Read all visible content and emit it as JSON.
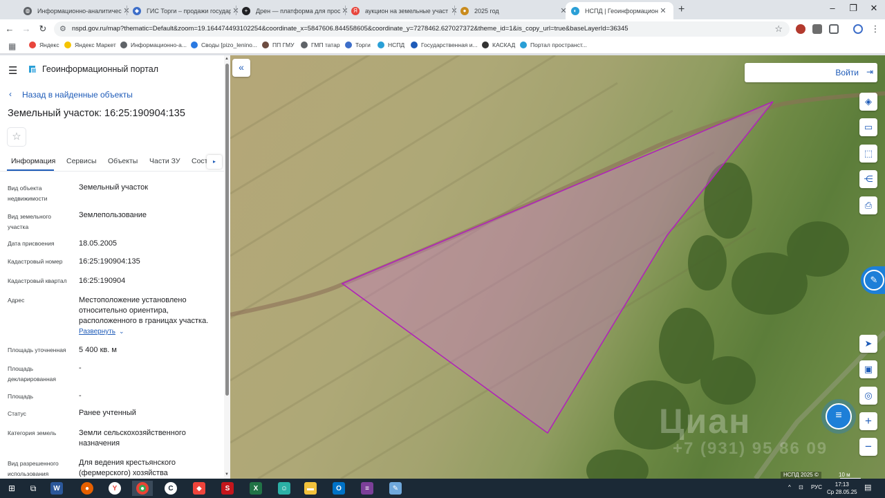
{
  "browser": {
    "tabs": [
      {
        "title": "Информационно-аналитичес",
        "color": "#5f6368",
        "active": false
      },
      {
        "title": "ГИС Торги – продажи государ",
        "color": "#3d6ec9",
        "active": false
      },
      {
        "title": "Дрен — платформа для прос",
        "color": "#202124",
        "active": false
      },
      {
        "title": "аукцион на земельные участ",
        "color": "#e8453c",
        "active": false
      },
      {
        "title": "2025 год",
        "color": "#c98b1d",
        "active": false
      },
      {
        "title": "НСПД | Геоинформационный",
        "color": "#2a9fd6",
        "active": true
      }
    ],
    "new_tab": "+",
    "url": "nspd.gov.ru/map?thematic=Default&zoom=19.164474493102254&coordinate_x=5847606.844558605&coordinate_y=7278462.627027372&theme_id=1&is_copy_url=true&baseLayerId=36345",
    "bookmarks": [
      {
        "label": "Яндекс",
        "color": "#e8453c"
      },
      {
        "label": "Яндекс Маркет",
        "color": "#f5c400"
      },
      {
        "label": "Информационно-а...",
        "color": "#5f6368"
      },
      {
        "label": "Своды [pizo_lenino...",
        "color": "#2a7ae2"
      },
      {
        "label": "ПП ГМУ",
        "color": "#6d4c41"
      },
      {
        "label": "ГМП татар",
        "color": "#5f6368"
      },
      {
        "label": "Торги",
        "color": "#3d6ec9"
      },
      {
        "label": "НСПД",
        "color": "#2a9fd6"
      },
      {
        "label": "Государственная и...",
        "color": "#1e5bb8"
      },
      {
        "label": "КАСКАД",
        "color": "#333333"
      },
      {
        "label": "Портал пространст...",
        "color": "#2a9fd6"
      }
    ]
  },
  "panel": {
    "portal_title": "Геоинформационный портал",
    "back_link": "Назад в найденные объекты",
    "object_title": "Земельный участок: 16:25:190904:135",
    "tabs": [
      "Информация",
      "Сервисы",
      "Объекты",
      "Части ЗУ",
      "Сост"
    ],
    "tab_arrow": "▸",
    "properties": [
      {
        "label": "Вид объекта недвижимости",
        "value": "Земельный участок"
      },
      {
        "label": "Вид земельного участка",
        "value": "Землепользование"
      },
      {
        "label": "Дата присвоения",
        "value": "18.05.2005"
      },
      {
        "label": "Кадастровый номер",
        "value": "16:25:190904:135"
      },
      {
        "label": "Кадастровый квартал",
        "value": "16:25:190904"
      },
      {
        "label": "Адрес",
        "value": "Местоположение установлено относительно ориентира, расположенного в границах участка."
      },
      {
        "label": "Площадь уточненная",
        "value": "5 400 кв. м"
      },
      {
        "label": "Площадь декларированная",
        "value": "-"
      },
      {
        "label": "Площадь",
        "value": "-"
      },
      {
        "label": "Статус",
        "value": "Ранее учтенный"
      },
      {
        "label": "Категория земель",
        "value": "Земли сельскохозяйственного назначения"
      },
      {
        "label": "Вид разрешенного использования",
        "value": "Для ведения крестьянского (фермерского) хозяйства"
      }
    ],
    "expand_label": "Развернуть"
  },
  "map": {
    "login_label": "Войти",
    "watermark_main": "Циан",
    "watermark_sub": "+7 (931) 95 86 09",
    "attribution": "НСПД 2025 ©",
    "scale_label": "10 м",
    "parcel_color": "#b023b8"
  },
  "taskbar": {
    "lang": "РУС",
    "time": "17:13",
    "date": "Ср 28.05.25"
  }
}
